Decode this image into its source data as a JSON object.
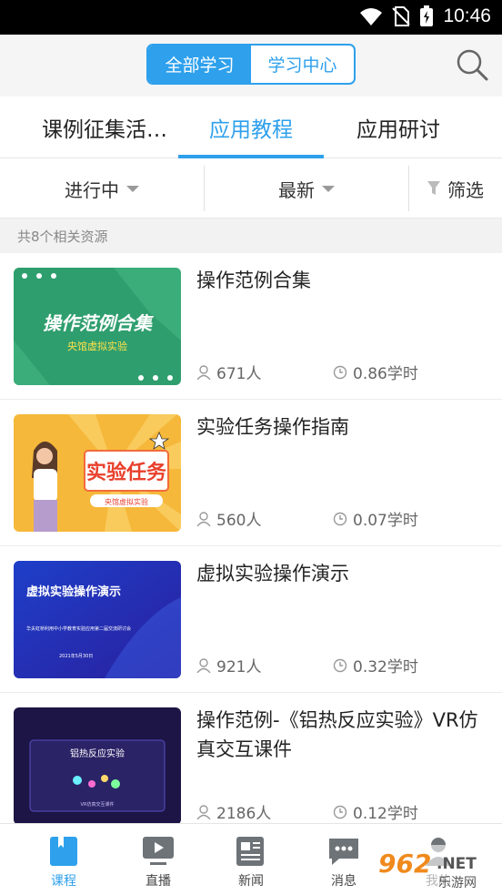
{
  "status_bar": {
    "time": "10:46"
  },
  "header": {
    "segments": [
      {
        "label": "全部学习",
        "active": true
      },
      {
        "label": "学习中心",
        "active": false
      }
    ],
    "search_icon": "search-icon",
    "accent": "#2ea0ec"
  },
  "tabs": [
    {
      "label": "课例征集活…"
    },
    {
      "label": "应用教程",
      "active": true
    },
    {
      "label": "应用研讨"
    }
  ],
  "filters": [
    {
      "label": "进行中"
    },
    {
      "label": "最新"
    },
    {
      "label": "筛选"
    }
  ],
  "count_text": "共8个相关资源",
  "items": [
    {
      "title": "操作范例合集",
      "people": "671人",
      "hours": "0.86学时",
      "thumb": {
        "headline": "操作范例合集",
        "sub": "央馆虚拟实验"
      }
    },
    {
      "title": "实验任务操作指南",
      "people": "560人",
      "hours": "0.07学时",
      "thumb": {
        "headline": "实验任务",
        "sub": "央馆虚拟实验"
      }
    },
    {
      "title": "虚拟实验操作演示",
      "people": "921人",
      "hours": "0.32学时",
      "thumb": {
        "headline": "虚拟实验操作演示",
        "sub": "华夫虹桥利用中小学教育实验应用第二届交流研讨会",
        "date": "2021年5月30日"
      }
    },
    {
      "title": "操作范例-《铝热反应实验》VR仿真交互课件",
      "people": "2186人",
      "hours": "0.12学时",
      "thumb": {
        "headline": "铝热反应实验",
        "sub": "VR仿真交互课件"
      }
    }
  ],
  "bottom_nav": [
    {
      "label": "课程",
      "active": true
    },
    {
      "label": "直播"
    },
    {
      "label": "新闻"
    },
    {
      "label": "消息"
    },
    {
      "label": "我的"
    }
  ],
  "watermark": "962.NET 乐游网"
}
